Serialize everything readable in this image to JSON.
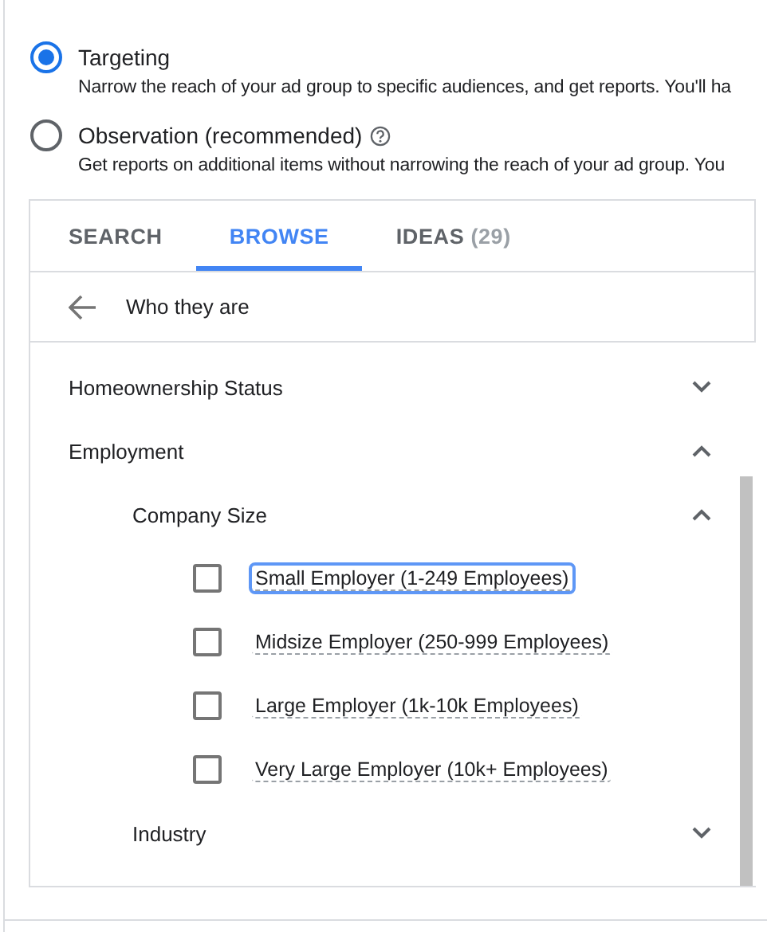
{
  "options": [
    {
      "label": "Targeting",
      "description": "Narrow the reach of your ad group to specific audiences, and get reports. You'll ha",
      "selected": true,
      "help": false
    },
    {
      "label": "Observation (recommended)",
      "description": "Get reports on additional items without narrowing the reach of your ad group. You",
      "selected": false,
      "help": true
    }
  ],
  "tabs": [
    {
      "label": "SEARCH",
      "selected": false
    },
    {
      "label": "BROWSE",
      "selected": true
    },
    {
      "label": "IDEAS",
      "count": "(29)",
      "selected": false
    }
  ],
  "breadcrumb": {
    "label": "Who they are"
  },
  "tree": [
    {
      "kind": "group",
      "label": "Homeownership Status",
      "expanded": false
    },
    {
      "kind": "group",
      "label": "Employment",
      "expanded": true,
      "children": [
        {
          "kind": "group",
          "label": "Company Size",
          "expanded": true,
          "children": [
            {
              "kind": "check",
              "label": "Small Employer (1-249 Employees)",
              "checked": false,
              "focused": true
            },
            {
              "kind": "check",
              "label": "Midsize Employer (250-999 Employees)",
              "checked": false,
              "focused": false
            },
            {
              "kind": "check",
              "label": "Large Employer (1k-10k Employees)",
              "checked": false,
              "focused": false
            },
            {
              "kind": "check",
              "label": "Very Large Employer (10k+ Employees)",
              "checked": false,
              "focused": false
            }
          ]
        },
        {
          "kind": "group",
          "label": "Industry",
          "expanded": false
        }
      ]
    }
  ]
}
